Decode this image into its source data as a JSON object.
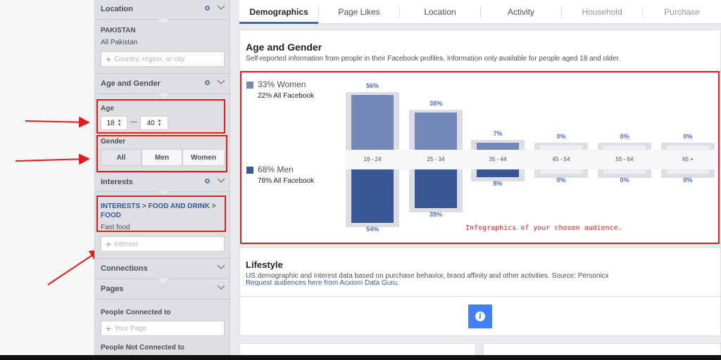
{
  "sidebar": {
    "location": {
      "heading": "Location",
      "country": "PAKISTAN",
      "region": "All Pakistan",
      "placeholder": "Country, region, or city"
    },
    "age_gender": {
      "heading": "Age and Gender",
      "age_label": "Age",
      "age_from": "18",
      "age_dash": "—",
      "age_to": "40",
      "gender_label": "Gender",
      "gender_options": [
        "All",
        "Men",
        "Women"
      ]
    },
    "interests": {
      "heading": "Interests",
      "path": [
        "INTERESTS",
        "FOOD AND DRINK",
        "FOOD"
      ],
      "separator": ">",
      "value": "Fast food",
      "placeholder": "Interest"
    },
    "connections": {
      "heading": "Connections"
    },
    "pages": {
      "heading": "Pages",
      "connected_label": "People Connected to",
      "connected_placeholder": "Your Page",
      "not_connected_label": "People Not Connected to"
    }
  },
  "tabs": [
    {
      "label": "Demographics",
      "active": true
    },
    {
      "label": "Page Likes",
      "active": false
    },
    {
      "label": "Location",
      "active": false
    },
    {
      "label": "Activity",
      "active": false
    },
    {
      "label": "Household",
      "active": false
    },
    {
      "label": "Purchase",
      "active": false
    }
  ],
  "age_gender_card": {
    "title": "Age and Gender",
    "subtitle": "Self-reported information from people in their Facebook profiles. Information only available for people aged 18 and older.",
    "women_label": "33% Women",
    "women_sub": "22% All Facebook",
    "men_label": "68% Men",
    "men_sub": "78% All Facebook",
    "annotation": "Infographics of your chosen audience."
  },
  "chart_data": {
    "type": "bar",
    "categories": [
      "18 - 24",
      "25 - 34",
      "35 - 44",
      "45 - 54",
      "55 - 64",
      "65 +"
    ],
    "series": [
      {
        "name": "Women",
        "values": [
          56,
          38,
          7,
          0,
          0,
          0
        ]
      },
      {
        "name": "Men",
        "values": [
          54,
          39,
          8,
          0,
          0,
          0
        ]
      }
    ],
    "value_labels": {
      "women": [
        "56%",
        "38%",
        "7%",
        "0%",
        "0%",
        "0%"
      ],
      "men": [
        "54%",
        "39%",
        "8%",
        "0%",
        "0%",
        "0%"
      ]
    },
    "ylim": [
      0,
      60
    ]
  },
  "lifestyle": {
    "title": "Lifestyle",
    "subtitle": "US demographic and interest data based on purchase behavior, brand affinity and other activities. Source: Personicx",
    "link": "Request audiences here from Acxiom Data Guru."
  },
  "colors": {
    "women": "#7388b7",
    "men": "#3a5795",
    "accent": "#4080ff",
    "highlight": "#e51a1a"
  }
}
